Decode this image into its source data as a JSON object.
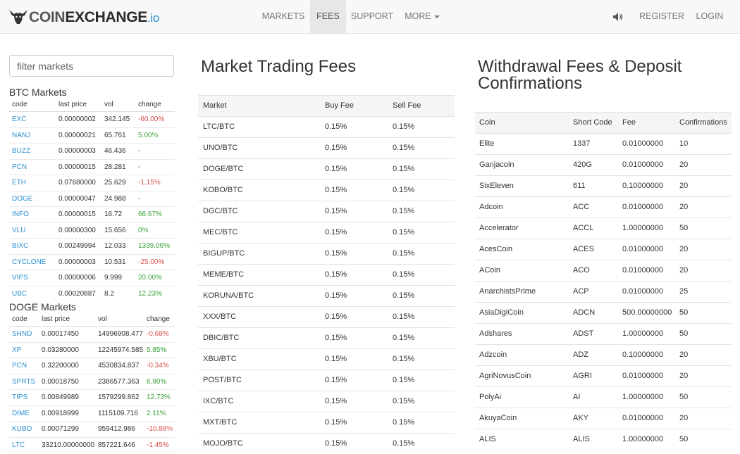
{
  "nav": {
    "logo_part1": "COIN",
    "logo_part2": "EXCHANGE",
    "logo_part3": ".io",
    "items": [
      "MARKETS",
      "FEES",
      "SUPPORT",
      "MORE"
    ],
    "register": "REGISTER",
    "login": "LOGIN"
  },
  "filter": {
    "placeholder": "filter markets"
  },
  "btc_markets": {
    "title": "BTC Markets",
    "headers": [
      "code",
      "last price",
      "vol",
      "change"
    ],
    "rows": [
      [
        "EXC",
        "0.00000002",
        "342.145",
        "-60.00%"
      ],
      [
        "NANJ",
        "0.00000021",
        "65.761",
        "5.00%"
      ],
      [
        "BUZZ",
        "0.00000003",
        "46.436",
        "-"
      ],
      [
        "PCN",
        "0.00000015",
        "28.281",
        "-"
      ],
      [
        "ETH",
        "0.07680000",
        "25.629",
        "-1.15%"
      ],
      [
        "DOGE",
        "0.00000047",
        "24.988",
        "-"
      ],
      [
        "INFO",
        "0.00000015",
        "16.72",
        "66.67%"
      ],
      [
        "VLU",
        "0.00000300",
        "15.656",
        "0%"
      ],
      [
        "BIXC",
        "0.00249994",
        "12.033",
        "1339.06%"
      ],
      [
        "CYCLONE",
        "0.00000003",
        "10.531",
        "-25.00%"
      ],
      [
        "VIPS",
        "0.00000006",
        "9.999",
        "20.00%"
      ],
      [
        "UBC",
        "0.00020887",
        "8.2",
        "12.23%"
      ]
    ]
  },
  "doge_markets": {
    "title": "DOGE Markets",
    "headers": [
      "code",
      "last price",
      "vol",
      "change"
    ],
    "rows": [
      [
        "SHND",
        "0.00017450",
        "14996908.477",
        "-0.68%"
      ],
      [
        "XP",
        "0.03280000",
        "12245974.585",
        "5.85%"
      ],
      [
        "PCN",
        "0.32200000",
        "4530834.837",
        "-0.34%"
      ],
      [
        "SPRTS",
        "0.00018750",
        "2386577.363",
        "6.90%"
      ],
      [
        "TIPS",
        "0.00849989",
        "1579299.862",
        "12.73%"
      ],
      [
        "DIME",
        "0.00918999",
        "1115109.716",
        "2.11%"
      ],
      [
        "KUBO",
        "0.00071299",
        "959412.986",
        "-10.88%"
      ],
      [
        "LTC",
        "33210.00000000",
        "857221.646",
        "-1.45%"
      ]
    ]
  },
  "trading_fees": {
    "title": "Market Trading Fees",
    "headers": [
      "Market",
      "Buy Fee",
      "Sell Fee"
    ],
    "rows": [
      [
        "LTC/BTC",
        "0.15%",
        "0.15%"
      ],
      [
        "UNO/BTC",
        "0.15%",
        "0.15%"
      ],
      [
        "DOGE/BTC",
        "0.15%",
        "0.15%"
      ],
      [
        "KOBO/BTC",
        "0.15%",
        "0.15%"
      ],
      [
        "DGC/BTC",
        "0.15%",
        "0.15%"
      ],
      [
        "MEC/BTC",
        "0.15%",
        "0.15%"
      ],
      [
        "BIGUP/BTC",
        "0.15%",
        "0.15%"
      ],
      [
        "MEME/BTC",
        "0.15%",
        "0.15%"
      ],
      [
        "KORUNA/BTC",
        "0.15%",
        "0.15%"
      ],
      [
        "XXX/BTC",
        "0.15%",
        "0.15%"
      ],
      [
        "DBIC/BTC",
        "0.15%",
        "0.15%"
      ],
      [
        "XBU/BTC",
        "0.15%",
        "0.15%"
      ],
      [
        "POST/BTC",
        "0.15%",
        "0.15%"
      ],
      [
        "IXC/BTC",
        "0.15%",
        "0.15%"
      ],
      [
        "MXT/BTC",
        "0.15%",
        "0.15%"
      ],
      [
        "MOJO/BTC",
        "0.15%",
        "0.15%"
      ]
    ]
  },
  "withdrawal_fees": {
    "title_line1": "Withdrawal Fees & Deposit",
    "title_line2": "Confirmations",
    "headers": [
      "Coin",
      "Short Code",
      "Fee",
      "Confirmations"
    ],
    "rows": [
      [
        "Elite",
        "1337",
        "0.01000000",
        "10"
      ],
      [
        "Ganjacoin",
        "420G",
        "0.01000000",
        "20"
      ],
      [
        "SixEleven",
        "611",
        "0.10000000",
        "20"
      ],
      [
        "Adcoin",
        "ACC",
        "0.01000000",
        "20"
      ],
      [
        "Accelerator",
        "ACCL",
        "1.00000000",
        "50"
      ],
      [
        "AcesCoin",
        "ACES",
        "0.01000000",
        "20"
      ],
      [
        "ACoin",
        "ACO",
        "0.01000000",
        "20"
      ],
      [
        "AnarchistsPrime",
        "ACP",
        "0.01000000",
        "25"
      ],
      [
        "AsiaDigiCoin",
        "ADCN",
        "500.00000000",
        "50"
      ],
      [
        "Adshares",
        "ADST",
        "1.00000000",
        "50"
      ],
      [
        "Adzcoin",
        "ADZ",
        "0.10000000",
        "20"
      ],
      [
        "AgriNovusCoin",
        "AGRI",
        "0.01000000",
        "20"
      ],
      [
        "PolyAi",
        "AI",
        "1.00000000",
        "50"
      ],
      [
        "AkuyaCoin",
        "AKY",
        "0.01000000",
        "20"
      ],
      [
        "ALIS",
        "ALIS",
        "1.00000000",
        "50"
      ]
    ]
  },
  "colors": {
    "link": "#2a8fd0",
    "positive": "#3ca23c",
    "negative": "#d9534f"
  }
}
